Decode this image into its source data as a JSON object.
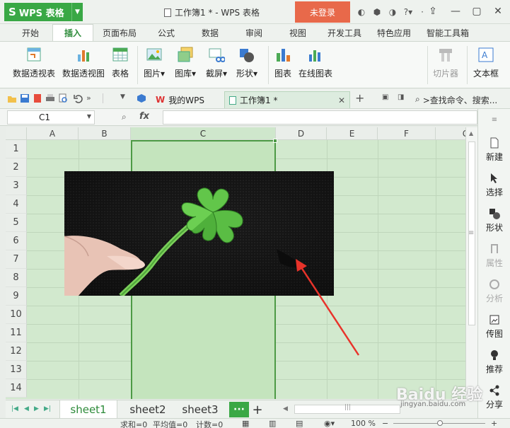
{
  "app": {
    "name": "WPS 表格",
    "logo": "S"
  },
  "window": {
    "title": "工作簿1 * - WPS 表格",
    "login_label": "未登录"
  },
  "ribbon_tabs": [
    "开始",
    "插入",
    "页面布局",
    "公式",
    "数据",
    "审阅",
    "视图",
    "开发工具",
    "特色应用",
    "智能工具箱"
  ],
  "active_tab": "插入",
  "ribbon": {
    "pivot_table": "数据透视表",
    "pivot_chart": "数据透视图",
    "table": "表格",
    "picture": "图片",
    "gallery": "图库",
    "screenshot": "截屏",
    "shape": "形状",
    "chart": "图表",
    "online_chart": "在线图表",
    "clip": "切片器",
    "textbox": "文本框"
  },
  "doc_tabs": {
    "wps": "我的WPS",
    "workbook": "工作簿1 *",
    "search": ">查找命令、搜索..."
  },
  "formula_bar": {
    "cell_ref": "C1",
    "fx": "fx",
    "value": ""
  },
  "columns": [
    "A",
    "B",
    "C",
    "D",
    "E",
    "F",
    "G"
  ],
  "selected_column": "C",
  "rows": [
    "1",
    "2",
    "3",
    "4",
    "5",
    "6",
    "7",
    "8",
    "9",
    "10",
    "11",
    "12",
    "13",
    "14"
  ],
  "sheets": [
    "sheet1",
    "sheet2",
    "sheet3"
  ],
  "active_sheet": "sheet1",
  "more_sheets": "···",
  "add_sheet": "+",
  "status": {
    "sum": "求和=0",
    "avg": "平均值=0",
    "count": "计数=0",
    "zoom": "100 %"
  },
  "right_pane": {
    "new": "新建",
    "select": "选择",
    "shape": "形状",
    "props": "属性",
    "analyze": "分析",
    "pic_to_image": "传图",
    "recommend": "推荐",
    "share": "分享"
  },
  "watermark": {
    "main": "Baidu 经验",
    "sub": "jingyan.baidu.com"
  },
  "colors": {
    "accent": "#39a845",
    "login": "#e8694a",
    "selection": "#4d9a45",
    "arrow": "#e8332a"
  }
}
